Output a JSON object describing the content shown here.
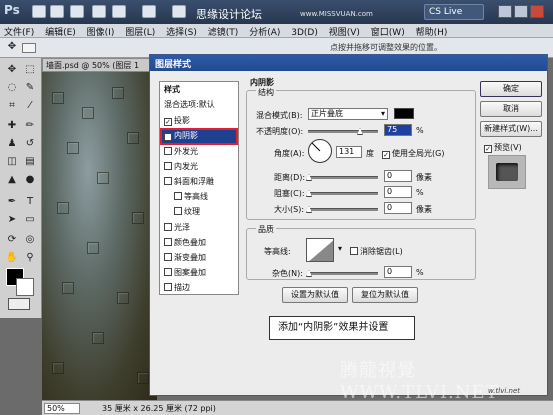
{
  "app": {
    "logo": "Ps",
    "watermark_top": "思缘设计论坛",
    "watermark_url": "www.MISSVUAN.com",
    "cs_live": "CS Live",
    "menu": [
      "文件(F)",
      "编辑(E)",
      "图像(I)",
      "图层(L)",
      "选择(S)",
      "滤镜(T)",
      "分析(A)",
      "3D(D)",
      "视图(V)",
      "窗口(W)",
      "帮助(H)"
    ],
    "options_hint": "点按并拖移可调整效果的位置。"
  },
  "document": {
    "tab": "墙面.psd @ 50% (图层 1",
    "zoom": "50%",
    "size": "35 厘米 x 26.25 厘米 (72 ppi)"
  },
  "dialog": {
    "title": "图层样式",
    "styles_header": "样式",
    "blend_options": "混合选项:默认",
    "style_items": [
      {
        "label": "投影",
        "checked": true
      },
      {
        "label": "内阴影",
        "checked": true
      },
      {
        "label": "外发光",
        "checked": false
      },
      {
        "label": "内发光",
        "checked": false
      },
      {
        "label": "斜面和浮雕",
        "checked": false
      },
      {
        "label": "等高线",
        "checked": false
      },
      {
        "label": "纹理",
        "checked": false
      },
      {
        "label": "光泽",
        "checked": false
      },
      {
        "label": "颜色叠加",
        "checked": false
      },
      {
        "label": "渐变叠加",
        "checked": false
      },
      {
        "label": "图案叠加",
        "checked": false
      },
      {
        "label": "描边",
        "checked": false
      }
    ],
    "section_title": "内阴影",
    "structure_label": "结构",
    "blend_mode_label": "混合模式(B):",
    "blend_mode_value": "正片叠底",
    "opacity_label": "不透明度(O):",
    "opacity_value": "75",
    "angle_label": "角度(A):",
    "angle_value": "131",
    "degree_unit": "度",
    "global_light_label": "使用全局光(G)",
    "global_light_checked": true,
    "distance_label": "距离(D):",
    "distance_value": "0",
    "choke_label": "阻塞(C):",
    "choke_value": "0",
    "size_label": "大小(S):",
    "size_value": "0",
    "px_unit": "像素",
    "percent_unit": "%",
    "quality_label": "品质",
    "contour_label": "等高线:",
    "antialias_label": "消除锯齿(L)",
    "noise_label": "杂色(N):",
    "noise_value": "0",
    "set_default_button": "设置为默认值",
    "reset_default_button": "复位为默认值",
    "ok_button": "确定",
    "cancel_button": "取消",
    "new_style_button": "新建样式(W)...",
    "preview_label": "预览(V)",
    "preview_checked": true
  },
  "annotation": "添加“内阴影”效果并设置",
  "site_watermark": "腾龍視覺 WWW.TLVI.NET",
  "corner_watermark": "w.tlvi.net"
}
